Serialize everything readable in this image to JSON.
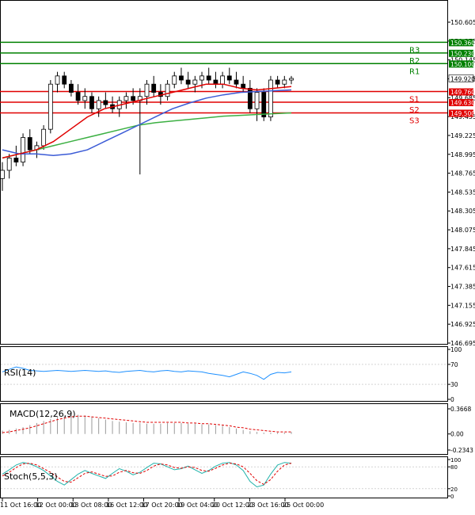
{
  "chart_data": {
    "type": "candlestick",
    "main": {
      "price_ticks": [
        "150.605",
        "150.375",
        "150.145",
        "149.915",
        "149.685",
        "149.455",
        "149.225",
        "148.995",
        "148.765",
        "148.535",
        "148.305",
        "148.075",
        "147.845",
        "147.615",
        "147.385",
        "147.155",
        "146.925",
        "146.695"
      ],
      "last_price": "149.920",
      "levels": [
        {
          "label": "R3",
          "value": 150.36,
          "tag": "150.360",
          "color": "#008000"
        },
        {
          "label": "R2",
          "value": 150.23,
          "tag": "150.230",
          "color": "#008000"
        },
        {
          "label": "R1",
          "value": 150.1,
          "tag": "150.100",
          "color": "#008000"
        },
        {
          "label": "S1",
          "value": 149.76,
          "tag": "149.760",
          "color": "#e00000"
        },
        {
          "label": "S2",
          "value": 149.63,
          "tag": "149.630",
          "color": "#e00000"
        },
        {
          "label": "S3",
          "value": 149.5,
          "tag": "149.500",
          "color": "#e00000"
        }
      ],
      "x_labels": [
        "11 Oct 16:00",
        "12 Oct 00:00",
        "13 Oct 08:00",
        "16 Oct 12:00",
        "17 Oct 20:00",
        "19 Oct 04:00",
        "20 Oct 12:00",
        "23 Oct 16:00",
        "25 Oct 00:00"
      ],
      "candles": [
        [
          148.7,
          148.9,
          148.55,
          148.8
        ],
        [
          148.8,
          149.0,
          148.7,
          148.95
        ],
        [
          148.95,
          149.1,
          148.85,
          148.9
        ],
        [
          148.9,
          149.25,
          148.85,
          149.2
        ],
        [
          149.2,
          149.3,
          149.0,
          149.05
        ],
        [
          149.05,
          149.15,
          148.95,
          149.1
        ],
        [
          149.1,
          149.35,
          149.05,
          149.3
        ],
        [
          149.3,
          149.9,
          149.25,
          149.85
        ],
        [
          149.85,
          150.0,
          149.75,
          149.95
        ],
        [
          149.95,
          150.0,
          149.8,
          149.85
        ],
        [
          149.85,
          149.9,
          149.7,
          149.75
        ],
        [
          149.75,
          149.85,
          149.6,
          149.65
        ],
        [
          149.65,
          149.8,
          149.55,
          149.7
        ],
        [
          149.7,
          149.75,
          149.5,
          149.55
        ],
        [
          149.55,
          149.7,
          149.45,
          149.65
        ],
        [
          149.65,
          149.75,
          149.55,
          149.6
        ],
        [
          149.6,
          149.7,
          149.5,
          149.55
        ],
        [
          149.55,
          149.7,
          149.45,
          149.65
        ],
        [
          149.65,
          149.75,
          149.55,
          149.7
        ],
        [
          149.7,
          149.8,
          149.6,
          149.65
        ],
        [
          149.65,
          149.8,
          148.75,
          149.7
        ],
        [
          149.7,
          149.9,
          149.6,
          149.85
        ],
        [
          149.85,
          149.95,
          149.7,
          149.75
        ],
        [
          149.75,
          149.85,
          149.6,
          149.7
        ],
        [
          149.7,
          149.9,
          149.65,
          149.85
        ],
        [
          149.85,
          150.0,
          149.8,
          149.95
        ],
        [
          149.95,
          150.05,
          149.85,
          149.9
        ],
        [
          149.9,
          150.0,
          149.8,
          149.85
        ],
        [
          149.85,
          149.95,
          149.75,
          149.9
        ],
        [
          149.9,
          150.0,
          149.8,
          149.95
        ],
        [
          149.95,
          150.05,
          149.85,
          149.9
        ],
        [
          149.9,
          150.0,
          149.8,
          149.85
        ],
        [
          149.85,
          150.0,
          149.8,
          149.95
        ],
        [
          149.95,
          150.05,
          149.85,
          149.9
        ],
        [
          149.9,
          150.0,
          149.8,
          149.85
        ],
        [
          149.85,
          149.95,
          149.75,
          149.8
        ],
        [
          149.8,
          149.9,
          149.5,
          149.55
        ],
        [
          149.55,
          149.8,
          149.4,
          149.75
        ],
        [
          149.75,
          149.8,
          149.4,
          149.45
        ],
        [
          149.45,
          149.95,
          149.4,
          149.9
        ],
        [
          149.9,
          149.95,
          149.8,
          149.85
        ],
        [
          149.85,
          149.95,
          149.8,
          149.9
        ],
        [
          149.9,
          149.95,
          149.85,
          149.92
        ]
      ],
      "ma_fast": [
        148.95,
        149.0,
        149.05,
        149.15,
        149.3,
        149.45,
        149.55,
        149.6,
        149.65,
        149.7,
        149.75,
        149.8,
        149.85,
        149.85,
        149.8,
        149.78,
        149.8,
        149.82
      ],
      "ma_medium": [
        149.05,
        149.0,
        149.0,
        148.98,
        149.0,
        149.05,
        149.15,
        149.25,
        149.35,
        149.45,
        149.55,
        149.62,
        149.68,
        149.72,
        149.75,
        149.76,
        149.77,
        149.78
      ],
      "ma_slow": [
        148.95,
        149.0,
        149.05,
        149.1,
        149.15,
        149.2,
        149.25,
        149.3,
        149.35,
        149.38,
        149.4,
        149.42,
        149.44,
        149.46,
        149.47,
        149.48,
        149.49,
        149.5
      ]
    },
    "rsi": {
      "label": "RSI(14)",
      "ticks": [
        "100",
        "70",
        "30",
        "0"
      ],
      "values": [
        55,
        60,
        65,
        62,
        58,
        57,
        56,
        57,
        58,
        57,
        56,
        57,
        58,
        57,
        56,
        57,
        55,
        54,
        56,
        57,
        58,
        56,
        55,
        57,
        58,
        56,
        55,
        57,
        56,
        55,
        52,
        50,
        48,
        45,
        50,
        55,
        52,
        48,
        40,
        50,
        54,
        53,
        55
      ]
    },
    "macd": {
      "label": "MACD(12,26,9)",
      "ticks": [
        "0.3668",
        "0.00",
        "-0.2343"
      ],
      "hist": [
        0.05,
        0.06,
        0.08,
        0.1,
        0.13,
        0.16,
        0.19,
        0.22,
        0.25,
        0.27,
        0.28,
        0.28,
        0.27,
        0.25,
        0.23,
        0.21,
        0.19,
        0.18,
        0.17,
        0.16,
        0.16,
        0.15,
        0.15,
        0.15,
        0.16,
        0.16,
        0.16,
        0.15,
        0.15,
        0.14,
        0.14,
        0.13,
        0.12,
        0.1,
        0.08,
        0.06,
        0.04,
        0.03,
        0.02,
        0.02,
        0.02,
        0.02,
        0.03
      ],
      "signal": [
        0.02,
        0.03,
        0.05,
        0.07,
        0.09,
        0.12,
        0.15,
        0.18,
        0.21,
        0.23,
        0.25,
        0.26,
        0.26,
        0.25,
        0.24,
        0.23,
        0.22,
        0.21,
        0.2,
        0.19,
        0.18,
        0.17,
        0.17,
        0.17,
        0.17,
        0.17,
        0.17,
        0.16,
        0.16,
        0.15,
        0.15,
        0.14,
        0.13,
        0.12,
        0.1,
        0.09,
        0.07,
        0.06,
        0.05,
        0.04,
        0.03,
        0.03,
        0.03
      ]
    },
    "stoch": {
      "label": "Stoch(5,5,3)",
      "ticks": [
        "100",
        "80",
        "20",
        "0"
      ],
      "k": [
        60,
        72,
        85,
        92,
        88,
        80,
        70,
        55,
        40,
        30,
        45,
        60,
        70,
        62,
        55,
        48,
        62,
        75,
        68,
        58,
        65,
        78,
        90,
        88,
        80,
        72,
        75,
        82,
        72,
        62,
        70,
        82,
        90,
        92,
        85,
        70,
        40,
        25,
        30,
        60,
        85,
        92,
        90
      ],
      "d": [
        55,
        65,
        78,
        88,
        90,
        85,
        75,
        65,
        52,
        40,
        38,
        50,
        62,
        66,
        60,
        54,
        55,
        65,
        70,
        64,
        62,
        70,
        82,
        88,
        85,
        78,
        76,
        80,
        78,
        70,
        68,
        76,
        85,
        90,
        88,
        80,
        62,
        42,
        32,
        45,
        68,
        85,
        90
      ]
    }
  }
}
